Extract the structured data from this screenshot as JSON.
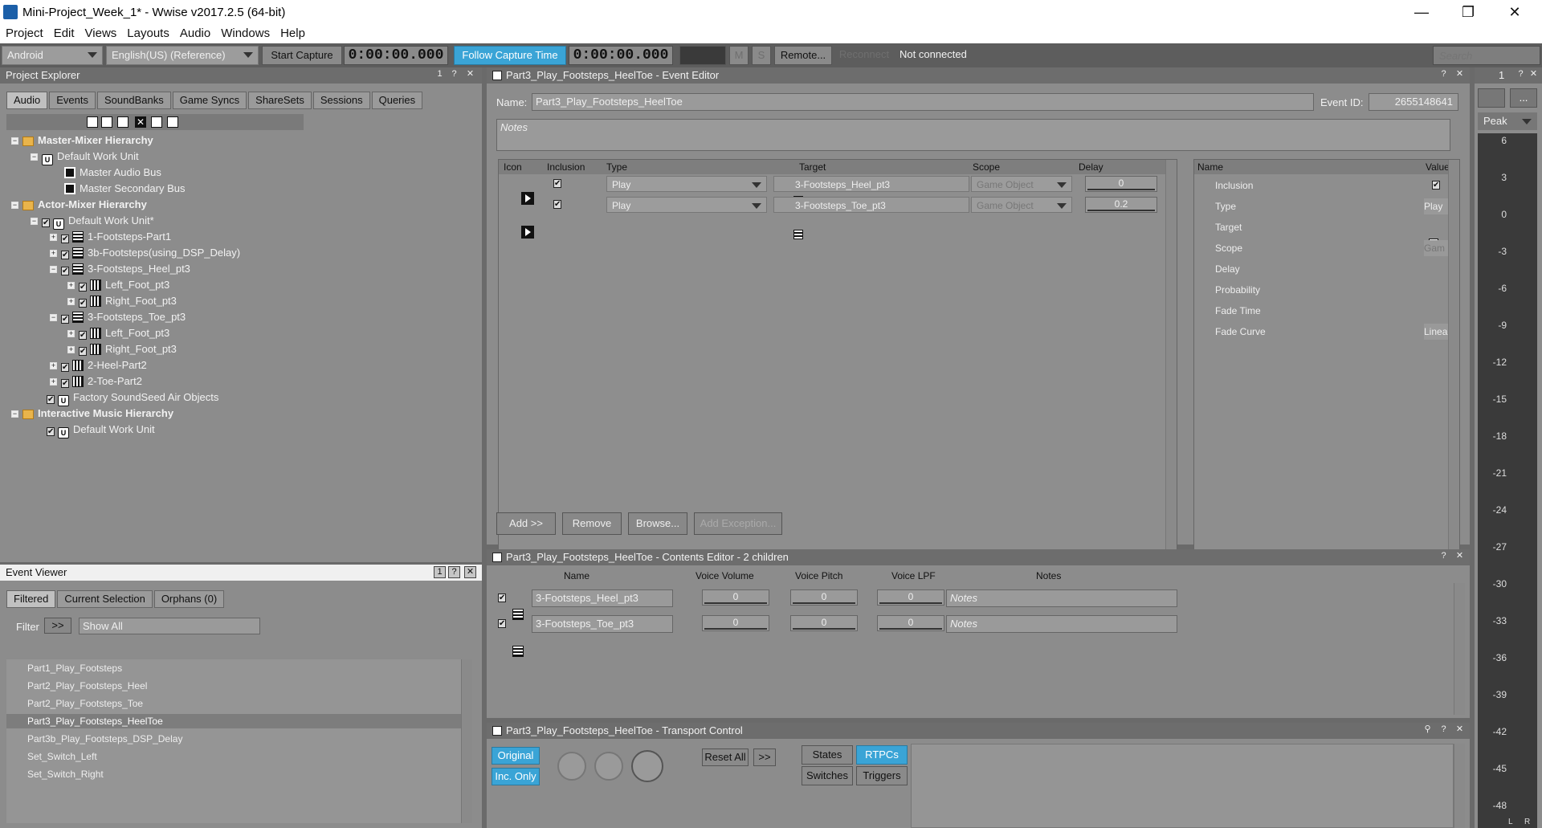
{
  "window": {
    "title": "Mini-Project_Week_1* - Wwise v2017.2.5 (64-bit)",
    "minimize": "—",
    "maximize": "❐",
    "close": "✕"
  },
  "menu": [
    "Project",
    "Edit",
    "Views",
    "Layouts",
    "Audio",
    "Windows",
    "Help"
  ],
  "toolbar": {
    "platform": "Android",
    "language": "English(US) (Reference)",
    "start_capture": "Start Capture",
    "capture_time": "0:00:00.000",
    "follow_capture": "Follow Capture Time",
    "follow_time": "0:00:00.000",
    "m": "M",
    "s": "S",
    "remote": "Remote...",
    "reconnect": "Reconnect",
    "status": "Not connected",
    "search_placeholder": "Search"
  },
  "project_explorer": {
    "title": "Project Explorer",
    "tabs": [
      "Audio",
      "Events",
      "SoundBanks",
      "Game Syncs",
      "ShareSets",
      "Sessions",
      "Queries"
    ],
    "tree": [
      {
        "label": "Master-Mixer Hierarchy"
      },
      {
        "label": "Default Work Unit"
      },
      {
        "label": "Master Audio Bus"
      },
      {
        "label": "Master Secondary Bus"
      },
      {
        "label": "Actor-Mixer Hierarchy"
      },
      {
        "label": "Default Work Unit*"
      },
      {
        "label": "1-Footsteps-Part1"
      },
      {
        "label": "3b-Footsteps(using_DSP_Delay)"
      },
      {
        "label": "3-Footsteps_Heel_pt3"
      },
      {
        "label": "Left_Foot_pt3"
      },
      {
        "label": "Right_Foot_pt3"
      },
      {
        "label": "3-Footsteps_Toe_pt3"
      },
      {
        "label": "Left_Foot_pt3"
      },
      {
        "label": "Right_Foot_pt3"
      },
      {
        "label": "2-Heel-Part2"
      },
      {
        "label": "2-Toe-Part2"
      },
      {
        "label": "Factory SoundSeed Air Objects"
      },
      {
        "label": "Interactive Music Hierarchy"
      },
      {
        "label": "Default Work Unit"
      }
    ]
  },
  "event_viewer": {
    "title": "Event Viewer",
    "tabs": [
      "Filtered",
      "Current Selection",
      "Orphans (0)"
    ],
    "filter_label": "Filter",
    "filter_btn": ">>",
    "show_all": "Show All",
    "events": [
      "Part1_Play_Footsteps",
      "Part2_Play_Footsteps_Heel",
      "Part2_Play_Footsteps_Toe",
      "Part3_Play_Footsteps_HeelToe",
      "Part3b_Play_Footsteps_DSP_Delay",
      "Set_Switch_Left",
      "Set_Switch_Right"
    ]
  },
  "event_editor": {
    "title": "Part3_Play_Footsteps_HeelToe - Event Editor",
    "name_label": "Name:",
    "name": "Part3_Play_Footsteps_HeelToe",
    "id_label": "Event ID:",
    "id": "2655148641",
    "notes_placeholder": "Notes",
    "columns": [
      "Icon",
      "Inclusion",
      "Type",
      "Target",
      "Scope",
      "Delay"
    ],
    "rows": [
      {
        "type": "Play",
        "target": "3-Footsteps_Heel_pt3",
        "scope": "Game Object",
        "delay": "0"
      },
      {
        "type": "Play",
        "target": "3-Footsteps_Toe_pt3",
        "scope": "Game Object",
        "delay": "0.2"
      }
    ],
    "prop_columns": [
      "Name",
      "Value"
    ],
    "props": [
      {
        "name": "Inclusion",
        "value": ""
      },
      {
        "name": "Type",
        "value": "Play"
      },
      {
        "name": "Target",
        "value": ""
      },
      {
        "name": "Scope",
        "value": "Gam"
      },
      {
        "name": "Delay",
        "value": ""
      },
      {
        "name": "Probability",
        "value": ""
      },
      {
        "name": "Fade Time",
        "value": ""
      },
      {
        "name": "Fade Curve",
        "value": "Linea"
      }
    ],
    "add": "Add >>",
    "remove": "Remove",
    "browse": "Browse...",
    "add_exception": "Add Exception..."
  },
  "contents_editor": {
    "title": "Part3_Play_Footsteps_HeelToe - Contents Editor - 2 children",
    "columns": [
      "Name",
      "Voice Volume",
      "Voice Pitch",
      "Voice LPF",
      "Notes"
    ],
    "rows": [
      {
        "name": "3-Footsteps_Heel_pt3",
        "vol": "0",
        "pitch": "0",
        "lpf": "0",
        "notes": "Notes"
      },
      {
        "name": "3-Footsteps_Toe_pt3",
        "vol": "0",
        "pitch": "0",
        "lpf": "0",
        "notes": "Notes"
      }
    ]
  },
  "transport": {
    "title": "Part3_Play_Footsteps_HeelToe - Transport Control",
    "original": "Original",
    "inc_only": "Inc. Only",
    "reset_all": "Reset All",
    "more": ">>",
    "states": "States",
    "rtpcs": "RTPCs",
    "switches": "Switches",
    "triggers": "Triggers"
  },
  "meter": {
    "mode": "Peak",
    "more": "...",
    "ticks": [
      "6",
      "3",
      "0",
      "-3",
      "-6",
      "-9",
      "-12",
      "-15",
      "-18",
      "-21",
      "-24",
      "-27",
      "-30",
      "-33",
      "-36",
      "-39",
      "-42",
      "-45",
      "-48"
    ],
    "l": "L",
    "r": "R"
  }
}
